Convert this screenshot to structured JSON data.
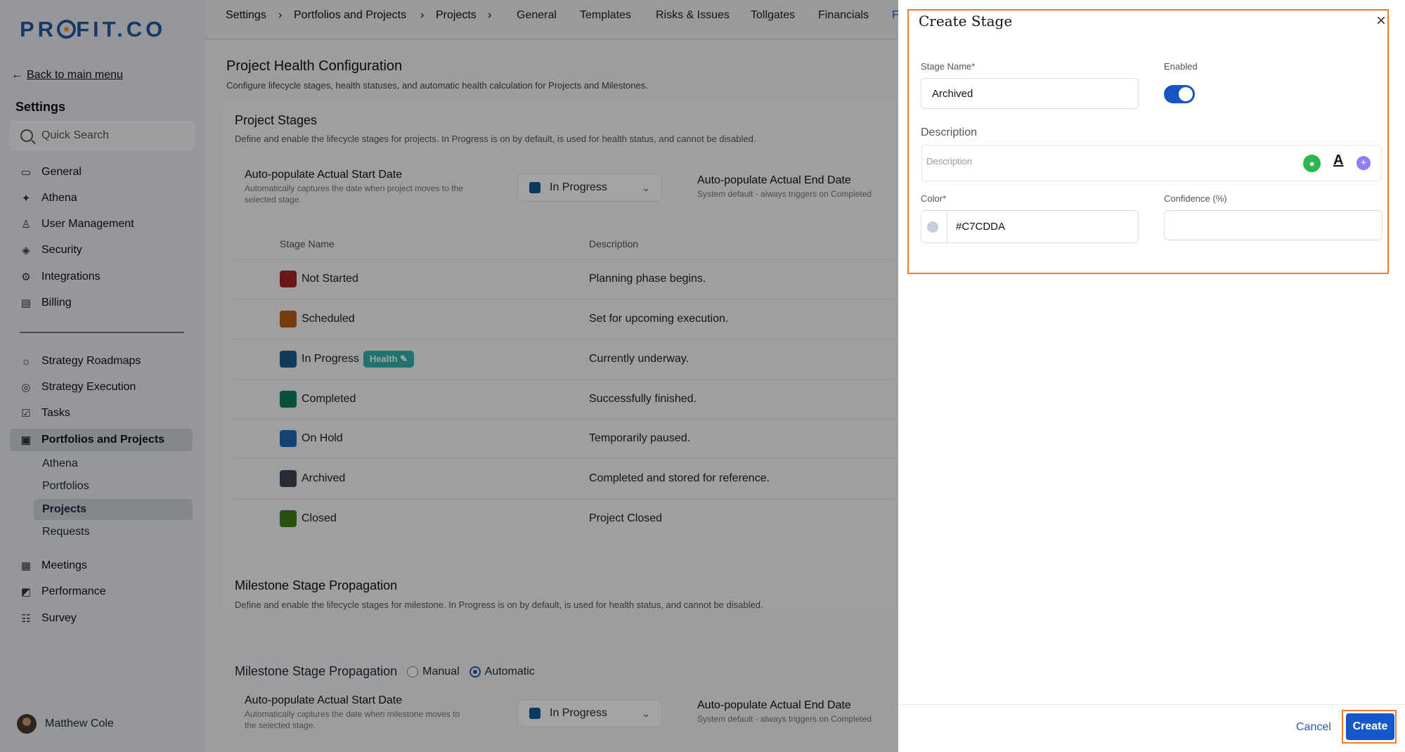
{
  "app": {
    "logo": "PR",
    "logo_end": "FIT.CO",
    "back": "Back to main menu",
    "settings": "Settings",
    "search_placeholder": "Quick Search",
    "user": "Matthew Cole"
  },
  "sidebar": {
    "top": [
      "General",
      "Athena",
      "User Management",
      "Security",
      "Integrations",
      "Billing"
    ],
    "bottom": [
      "Strategy Roadmaps",
      "Strategy Execution",
      "Tasks",
      "Portfolios and Projects"
    ],
    "sub": [
      "Athena",
      "Portfolios",
      "Projects",
      "Requests"
    ],
    "after": [
      "Meetings",
      "Performance",
      "Survey"
    ]
  },
  "breadcrumb": [
    "Settings",
    "Portfolios and Projects",
    "Projects"
  ],
  "tabs": [
    "General",
    "Templates",
    "Risks & Issues",
    "Tollgates",
    "Financials",
    "F"
  ],
  "main": {
    "title": "Project Health Configuration",
    "subtitle": "Configure lifecycle stages, health statuses, and automatic health calculation for Projects and Milestones.",
    "project_title": "Project Stages",
    "project_sub": "Define and enable the lifecycle stages for projects. In Progress is on by default, is used for health status, and cannot be disabled.",
    "auto_start": "Auto-populate Actual Start Date",
    "project_desc": "Automatically captures the date when project moves to the selected stage.",
    "auto_end": "Auto-populate Actual End Date",
    "end_desc": "System default - always triggers on Completed",
    "selected": "In Progress",
    "col_name": "Stage Name",
    "col_desc": "Description",
    "health": "Health",
    "milestone_title": "Milestone Stage Propagation",
    "milestone_sub": "Define and enable the lifecycle stages for milestone. In Progress is on by default, is used for health status, and cannot be disabled.",
    "milestone_label": "Milestone Stage Propagation",
    "manual": "Manual",
    "automatic": "Automatic",
    "milestone_desc": "Automatically captures the date when milestone moves to the selected stage."
  },
  "stages": [
    {
      "name": "Not Started",
      "desc": "Planning phase begins.",
      "color": "#a52725"
    },
    {
      "name": "Scheduled",
      "desc": "Set for upcoming execution.",
      "color": "#b85f16"
    },
    {
      "name": "In Progress",
      "desc": "Currently underway.",
      "color": "#1d5b91"
    },
    {
      "name": "Completed",
      "desc": "Successfully finished.",
      "color": "#0f7d60"
    },
    {
      "name": "On Hold",
      "desc": "Temporarily paused.",
      "color": "#1d69b3"
    },
    {
      "name": "Archived",
      "desc": "Completed and stored for reference.",
      "color": "#3d4651"
    },
    {
      "name": "Closed",
      "desc": "Project Closed",
      "color": "#407d16"
    }
  ],
  "modal": {
    "title": "Create Stage",
    "stage_label": "Stage Name*",
    "stage_value": "Archived",
    "enabled_label": "Enabled",
    "description_label": "Description",
    "description_placeholder": "Description",
    "color_label": "Color*",
    "color_value": "#C7CDDA",
    "confidence_label": "Confidence (%)",
    "cancel": "Cancel",
    "create": "Create"
  }
}
